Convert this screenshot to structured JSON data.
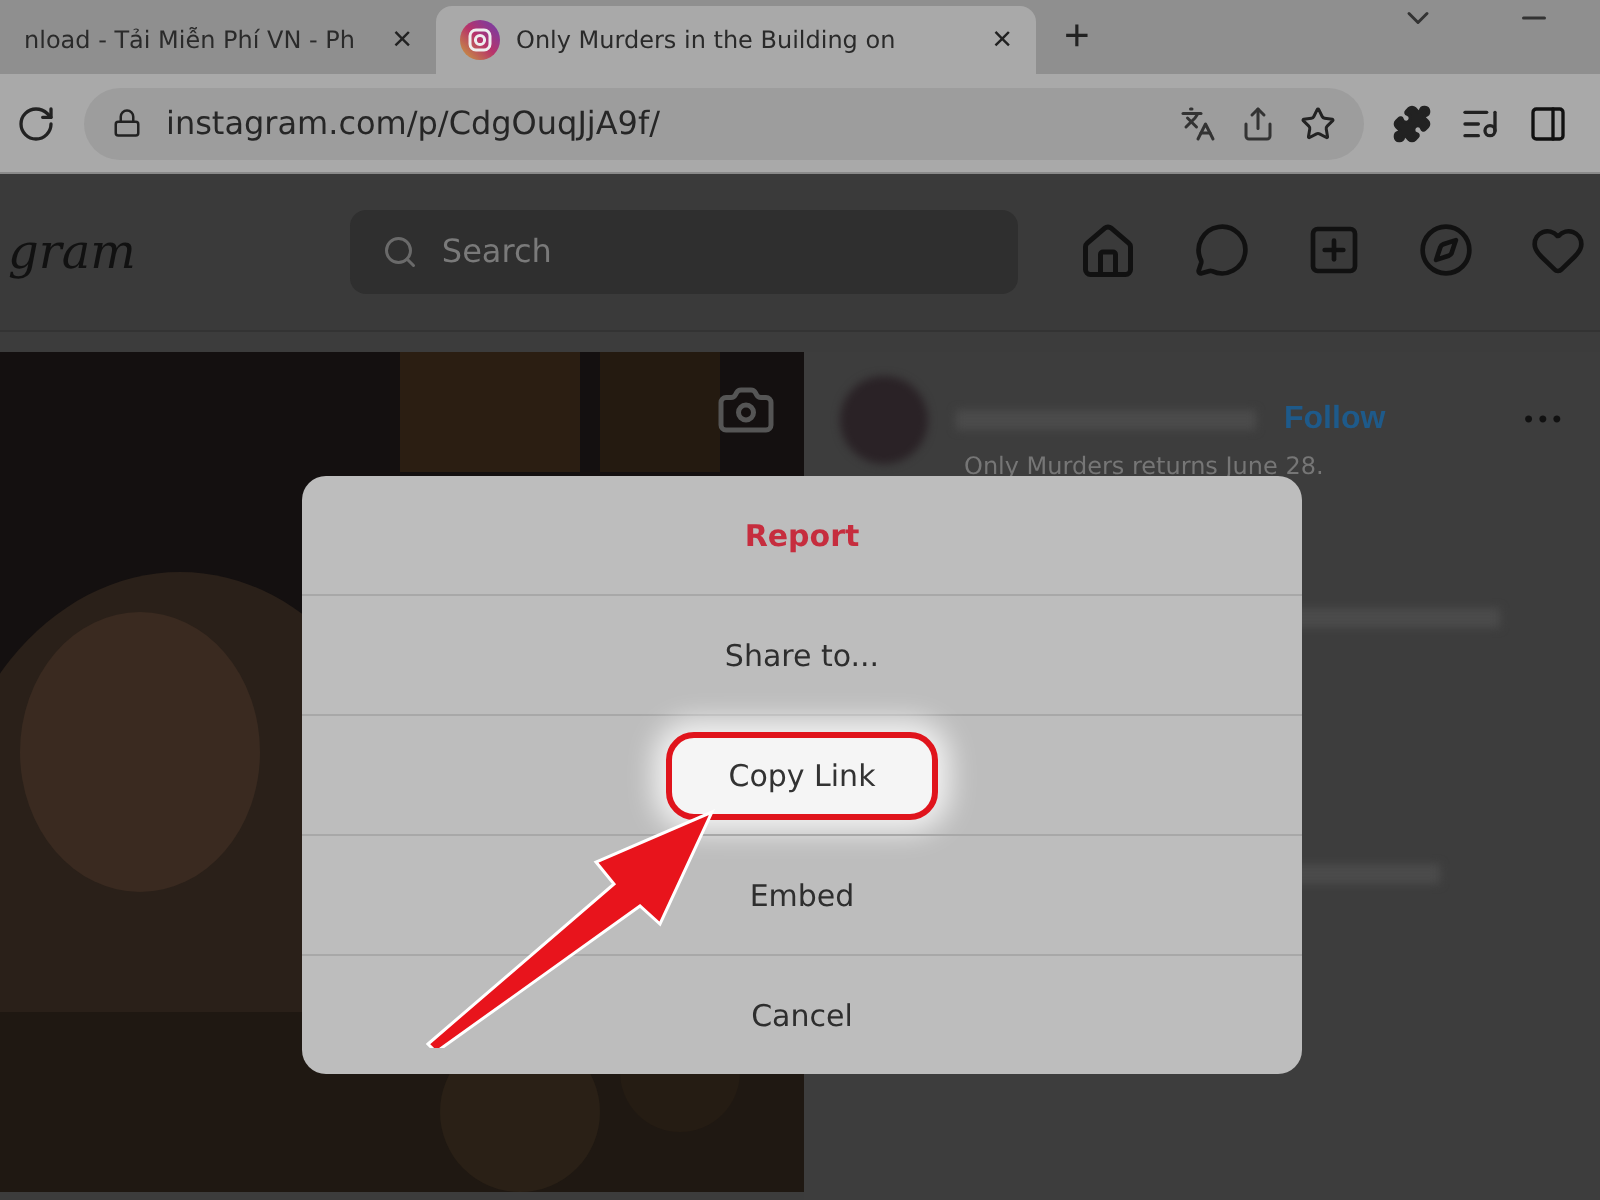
{
  "browser": {
    "tabs": [
      {
        "title": "nload - Tải Miễn Phí VN - Ph",
        "close": "×",
        "selected": false
      },
      {
        "title": "Only Murders in the Building on",
        "close": "×",
        "selected": true
      }
    ],
    "new_tab": "+",
    "address": "instagram.com/p/CdgOuqJjA9f/"
  },
  "header": {
    "logo": "gram",
    "search": {
      "placeholder": "Search"
    }
  },
  "post": {
    "follow": "Follow",
    "caption": "Only Murders returns June 28.",
    "more": "•••"
  },
  "dialog": {
    "items": [
      {
        "label": "Report",
        "kind": "danger",
        "highlighted": false
      },
      {
        "label": "Share to...",
        "kind": "normal",
        "highlighted": false
      },
      {
        "label": "Copy Link",
        "kind": "normal",
        "highlighted": true
      },
      {
        "label": "Embed",
        "kind": "normal",
        "highlighted": false
      },
      {
        "label": "Cancel",
        "kind": "normal",
        "highlighted": false
      }
    ]
  }
}
